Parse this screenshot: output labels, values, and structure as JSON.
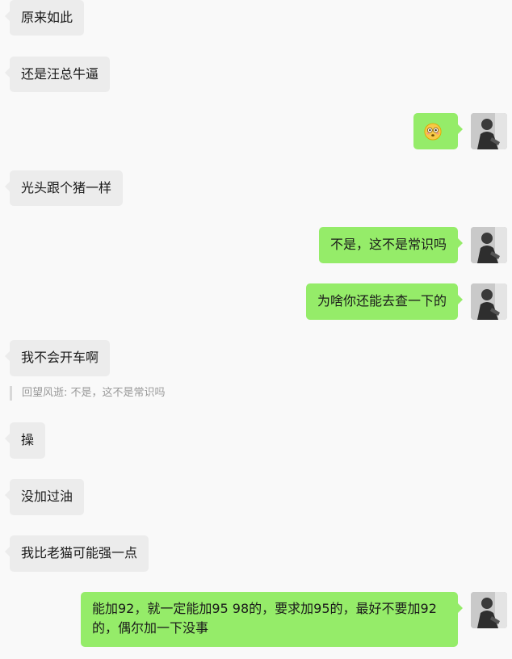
{
  "messages": [
    {
      "side": "left",
      "text": "原来如此"
    },
    {
      "side": "left",
      "text": "还是汪总牛逼"
    },
    {
      "side": "right",
      "type": "emoji",
      "emoji": "flushed-face-emoji"
    },
    {
      "side": "left",
      "text": "光头跟个猪一样"
    },
    {
      "side": "right",
      "text": "不是，这不是常识吗"
    },
    {
      "side": "right",
      "text": "为啥你还能去查一下的"
    },
    {
      "side": "left",
      "text": "我不会开车啊"
    },
    {
      "side": "left",
      "text": "操"
    },
    {
      "side": "left",
      "text": "没加过油"
    },
    {
      "side": "left",
      "text": "我比老猫可能强一点"
    },
    {
      "side": "right",
      "text": "能加92，就一定能加95 98的，要求加95的，最好不要加92的，偶尔加一下没事"
    }
  ],
  "quote": {
    "text": "回望风逝: 不是，这不是常识吗"
  },
  "colors": {
    "background": "#f9f9f9",
    "incoming_bubble": "#ececec",
    "outgoing_bubble": "#95ec69",
    "quote_text": "#999999"
  }
}
